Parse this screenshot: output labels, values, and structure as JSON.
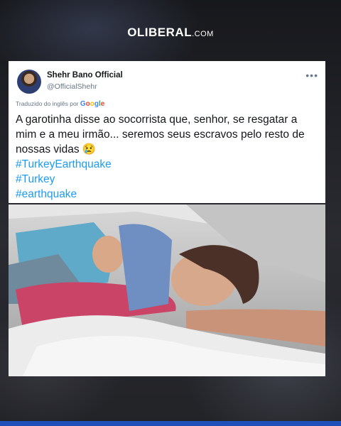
{
  "header": {
    "brand": "OLIBERAL",
    "domain_suffix": ".COM"
  },
  "tweet": {
    "author_name": "Shehr Bano Official",
    "author_handle": "@OfficialShehr",
    "more_label": "•••",
    "translated_label": "Traduzido do inglês por",
    "translator": "Google",
    "text": "A garotinha disse ao socorrista que, senhor, se resgatar a mim e a meu irmão... seremos seus escravos pelo resto de nossas vidas 😢",
    "hashtags": [
      "#TurkeyEarthquake",
      "#Turkey",
      "#earthquake"
    ]
  },
  "colors": {
    "hashtag": "#1d9bf0",
    "bottom_bar": "#1f4fb8",
    "background": "#1c1d21"
  },
  "icons": {
    "more": "more-horizontal-icon",
    "avatar": "profile-avatar"
  }
}
